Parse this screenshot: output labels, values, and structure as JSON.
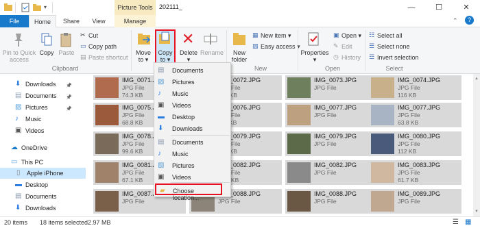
{
  "titlebar": {
    "picture_tools": "Picture Tools",
    "title": "202111_",
    "minimize": "—",
    "maximize": "☐",
    "close": "✕"
  },
  "tabs": [
    "File",
    "Home",
    "Share",
    "View",
    "Manage"
  ],
  "ribbon": {
    "clipboard": {
      "pin": "Pin to Quick\naccess",
      "copy": "Copy",
      "paste": "Paste",
      "cut": "Cut",
      "copy_path": "Copy path",
      "paste_shortcut": "Paste shortcut",
      "group": "Clipboard"
    },
    "organize": {
      "move_to": "Move\nto ▾",
      "copy_to": "Copy\nto ▾",
      "delete": "Delete\n▾",
      "rename": "Rename"
    },
    "new": {
      "new_folder": "New\nfolder",
      "new_item": "New item ▾",
      "easy_access": "Easy access ▾",
      "group": "New"
    },
    "open": {
      "properties": "Properties\n▾",
      "open": "Open ▾",
      "edit": "Edit",
      "history": "History",
      "group": "Open"
    },
    "select": {
      "select_all": "Select all",
      "select_none": "Select none",
      "invert": "Invert selection",
      "group": "Select"
    },
    "colors": {
      "accent": "#1979ca",
      "highlight": "#e81123"
    }
  },
  "nav": [
    {
      "label": "Downloads",
      "icon": "download-icon",
      "pinned": true
    },
    {
      "label": "Documents",
      "icon": "documents-icon",
      "pinned": true
    },
    {
      "label": "Pictures",
      "icon": "pictures-icon",
      "pinned": true
    },
    {
      "label": "Music",
      "icon": "music-icon",
      "pinned": false
    },
    {
      "label": "Videos",
      "icon": "videos-icon",
      "pinned": false
    },
    {
      "label": "OneDrive",
      "icon": "cloud-icon",
      "pinned": false
    },
    {
      "label": "This PC",
      "icon": "computer-icon",
      "pinned": false
    },
    {
      "label": "Apple iPhone",
      "icon": "phone-icon",
      "pinned": false,
      "selected": true
    },
    {
      "label": "Desktop",
      "icon": "desktop-icon",
      "pinned": false
    },
    {
      "label": "Documents",
      "icon": "documents-icon",
      "pinned": false
    },
    {
      "label": "Downloads",
      "icon": "download-icon",
      "pinned": false
    }
  ],
  "files": [
    {
      "name": "IMG_0071.JPG",
      "type": "JPG File",
      "size": "74.3 KB",
      "color": "#b06a4e"
    },
    {
      "name": "IMG_0072.JPG",
      "type": "JPG File",
      "size": "154 KB",
      "color": "#8aa0b8"
    },
    {
      "name": "IMG_0073.JPG",
      "type": "JPG File",
      "size": "",
      "color": "#6d7f5c"
    },
    {
      "name": "IMG_0074.JPG",
      "type": "JPG File",
      "size": "116 KB",
      "color": "#c7b08a"
    },
    {
      "name": "IMG_0075.JPG",
      "type": "JPG File",
      "size": "68.8 KB",
      "color": "#9b5a3c"
    },
    {
      "name": "IMG_0076.JPG",
      "type": "JPG File",
      "size": "117 KB",
      "color": "#8f8a80"
    },
    {
      "name": "IMG_0077.JPG",
      "type": "JPG File",
      "size": "",
      "color": "#bca080"
    },
    {
      "name": "IMG_0077.JPG",
      "type": "JPG File",
      "size": "63.8 KB",
      "color": "#a8b4c4"
    },
    {
      "name": "IMG_0078.JPG",
      "type": "JPG File",
      "size": "99.6 KB",
      "color": "#7a6a5a"
    },
    {
      "name": "IMG_0079.JPG",
      "type": "JPG File",
      "size": "124 KB",
      "color": "#b49a7c"
    },
    {
      "name": "IMG_0079.JPG",
      "type": "JPG File",
      "size": "",
      "color": "#5c6a4a"
    },
    {
      "name": "IMG_0080.JPG",
      "type": "JPG File",
      "size": "112 KB",
      "color": "#4a5a7a"
    },
    {
      "name": "IMG_0081.JPG",
      "type": "JPG File",
      "size": "67.1 KB",
      "color": "#a0826a"
    },
    {
      "name": "IMG_0082.JPG",
      "type": "JPG File",
      "size": "42.2 KB",
      "color": "#c4c4c4"
    },
    {
      "name": "IMG_0082.JPG",
      "type": "JPG File",
      "size": "",
      "color": "#8a8a8a"
    },
    {
      "name": "IMG_0083.JPG",
      "type": "JPG File",
      "size": "61.7 KB",
      "color": "#d0b8a0"
    },
    {
      "name": "IMG_0087.JPG",
      "type": "JPG File",
      "size": "",
      "color": "#7a6048"
    },
    {
      "name": "IMG_0088.JPG",
      "type": "JPG File",
      "size": "",
      "color": "#8c8478"
    },
    {
      "name": "IMG_0088.JPG",
      "type": "JPG File",
      "size": "",
      "color": "#6a5844"
    },
    {
      "name": "IMG_0089.JPG",
      "type": "JPG File",
      "size": "",
      "color": "#c0a890"
    }
  ],
  "menu": [
    {
      "label": "Documents",
      "icon": "documents-icon"
    },
    {
      "label": "Pictures",
      "icon": "pictures-icon"
    },
    {
      "label": "Music",
      "icon": "music-icon"
    },
    {
      "label": "Videos",
      "icon": "videos-icon"
    },
    {
      "label": "Desktop",
      "icon": "desktop-icon"
    },
    {
      "label": "Downloads",
      "icon": "download-icon"
    },
    {
      "label": "Documents",
      "icon": "documents-icon"
    },
    {
      "label": "Music",
      "icon": "music-icon"
    },
    {
      "label": "Pictures",
      "icon": "pictures-icon"
    },
    {
      "label": "Videos",
      "icon": "videos-icon"
    },
    {
      "label": "Choose location...",
      "icon": "folder-icon",
      "highlighted": true
    }
  ],
  "status": {
    "items": "20 items",
    "selected": "18 items selected",
    "size": "2.97 MB"
  }
}
